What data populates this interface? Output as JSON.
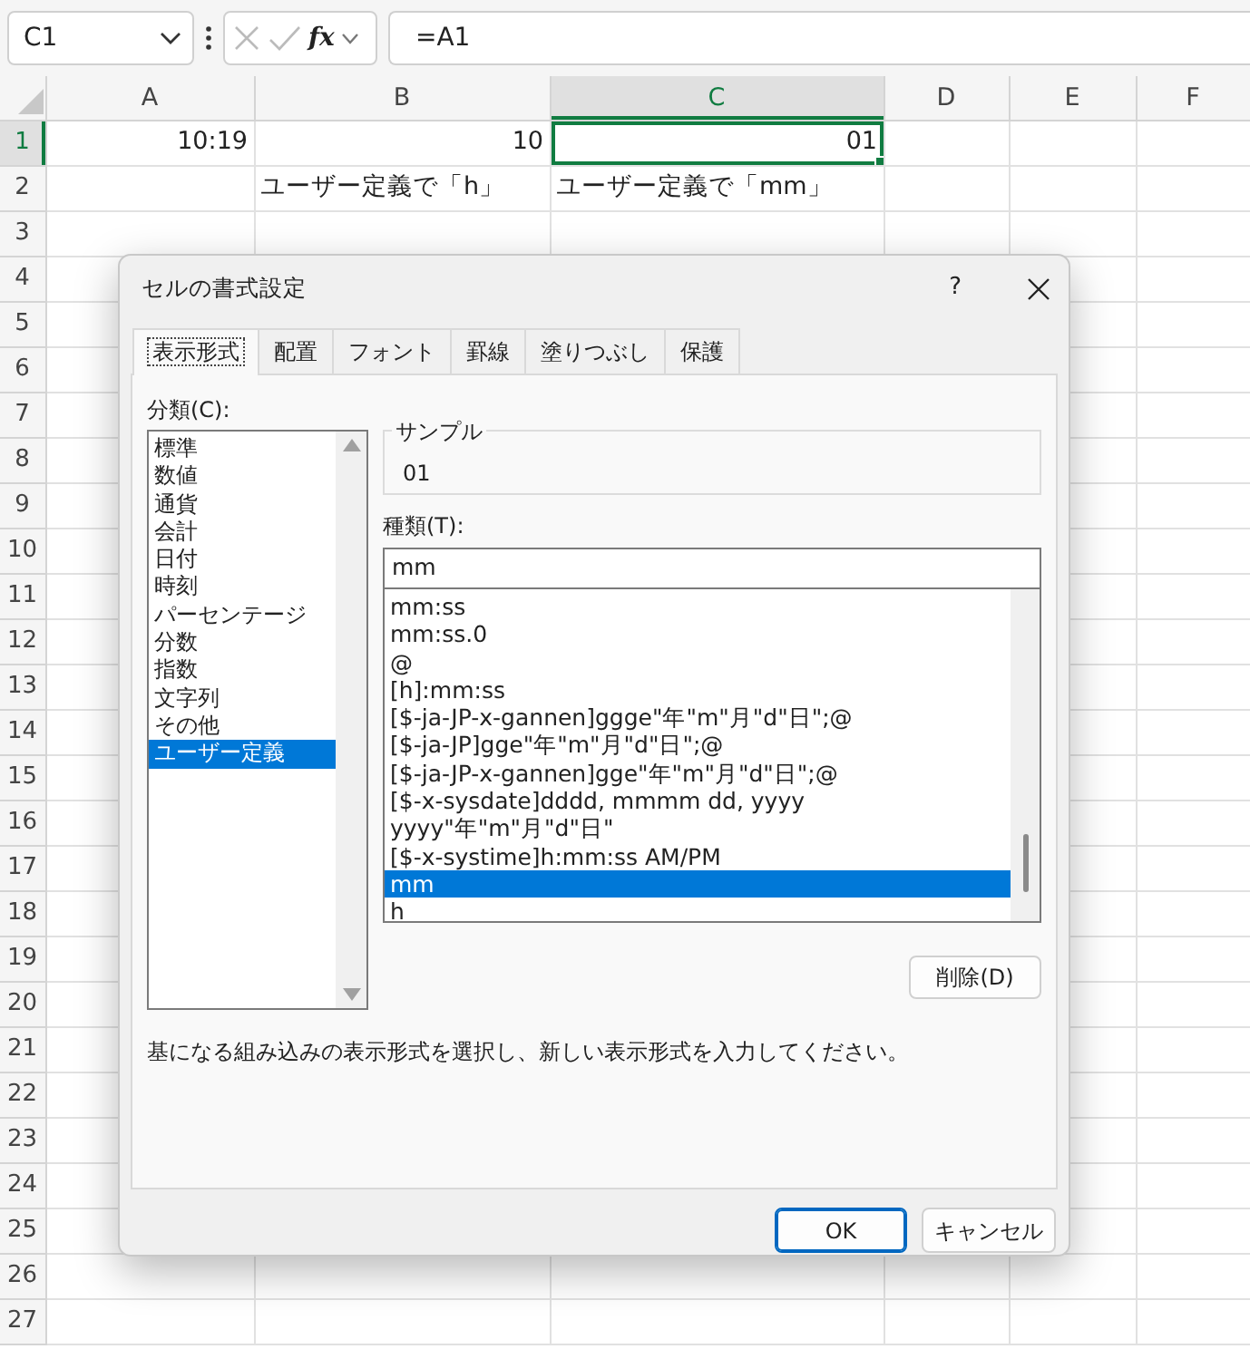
{
  "name_box": {
    "value": "C1"
  },
  "formula_bar": {
    "function_label": "fx",
    "value": "=A1"
  },
  "columns": [
    {
      "label": "A",
      "selected": false
    },
    {
      "label": "B",
      "selected": false
    },
    {
      "label": "C",
      "selected": true
    },
    {
      "label": "D",
      "selected": false
    },
    {
      "label": "E",
      "selected": false
    },
    {
      "label": "F",
      "selected": false
    }
  ],
  "rows": [
    {
      "label": "1",
      "cells": [
        {
          "text": "10:19",
          "active": false
        },
        {
          "text": "10",
          "active": false
        },
        {
          "text": "01",
          "active": true
        }
      ]
    },
    {
      "label": "2",
      "cells": [
        {
          "active": false
        },
        {
          "text": "ユーザー定義で「h」",
          "active": false
        },
        {
          "text": "ユーザー定義で「mm」",
          "active": false
        }
      ]
    },
    {
      "label": "3"
    },
    {
      "label": "4"
    },
    {
      "label": "5"
    },
    {
      "label": "6"
    },
    {
      "label": "7"
    },
    {
      "label": "8"
    },
    {
      "label": "9"
    },
    {
      "label": "10"
    },
    {
      "label": "11"
    },
    {
      "label": "12"
    },
    {
      "label": "13"
    },
    {
      "label": "14"
    },
    {
      "label": "15"
    },
    {
      "label": "16"
    },
    {
      "label": "17"
    },
    {
      "label": "18"
    },
    {
      "label": "19"
    },
    {
      "label": "20"
    },
    {
      "label": "21"
    },
    {
      "label": "22"
    },
    {
      "label": "23"
    },
    {
      "label": "24"
    },
    {
      "label": "25"
    },
    {
      "label": "26"
    },
    {
      "label": "27"
    }
  ],
  "dialog": {
    "title": "セルの書式設定",
    "help": "?",
    "tabs": [
      {
        "label": "表示形式",
        "selected": true
      },
      {
        "label": "配置",
        "selected": false
      },
      {
        "label": "フォント",
        "selected": false
      },
      {
        "label": "罫線",
        "selected": false
      },
      {
        "label": "塗りつぶし",
        "selected": false
      },
      {
        "label": "保護",
        "selected": false
      }
    ],
    "category_label": "分類(C):",
    "categories": [
      {
        "label": "標準",
        "selected": false
      },
      {
        "label": "数値",
        "selected": false
      },
      {
        "label": "通貨",
        "selected": false
      },
      {
        "label": "会計",
        "selected": false
      },
      {
        "label": "日付",
        "selected": false
      },
      {
        "label": "時刻",
        "selected": false
      },
      {
        "label": "パーセンテージ",
        "selected": false
      },
      {
        "label": "分数",
        "selected": false
      },
      {
        "label": "指数",
        "selected": false
      },
      {
        "label": "文字列",
        "selected": false
      },
      {
        "label": "その他",
        "selected": false
      },
      {
        "label": "ユーザー定義",
        "selected": true
      }
    ],
    "sample": {
      "label": "サンプル",
      "value": "01"
    },
    "type_label": "種類(T):",
    "type_input": {
      "value": "mm"
    },
    "formats": [
      {
        "label": "mm:ss",
        "selected": false
      },
      {
        "label": "mm:ss.0",
        "selected": false
      },
      {
        "label": "@",
        "selected": false
      },
      {
        "label": "[h]:mm:ss",
        "selected": false
      },
      {
        "label": "[$-ja-JP-x-gannen]ggge\"年\"m\"月\"d\"日\";@",
        "selected": false
      },
      {
        "label": "[$-ja-JP]gge\"年\"m\"月\"d\"日\";@",
        "selected": false
      },
      {
        "label": "[$-ja-JP-x-gannen]gge\"年\"m\"月\"d\"日\";@",
        "selected": false
      },
      {
        "label": "[$-x-sysdate]dddd, mmmm dd, yyyy",
        "selected": false
      },
      {
        "label": "yyyy\"年\"m\"月\"d\"日\"",
        "selected": false
      },
      {
        "label": "[$-x-systime]h:mm:ss AM/PM",
        "selected": false
      },
      {
        "label": "mm",
        "selected": true
      },
      {
        "label": "h",
        "selected": false
      }
    ],
    "delete_button": {
      "label": "削除(D)"
    },
    "description": "基になる組み込みの表示形式を選択し、新しい表示形式を入力してください。",
    "buttons": [
      {
        "label": "OK",
        "kind": "default"
      },
      {
        "label": "キャンセル",
        "kind": "normal"
      }
    ]
  }
}
